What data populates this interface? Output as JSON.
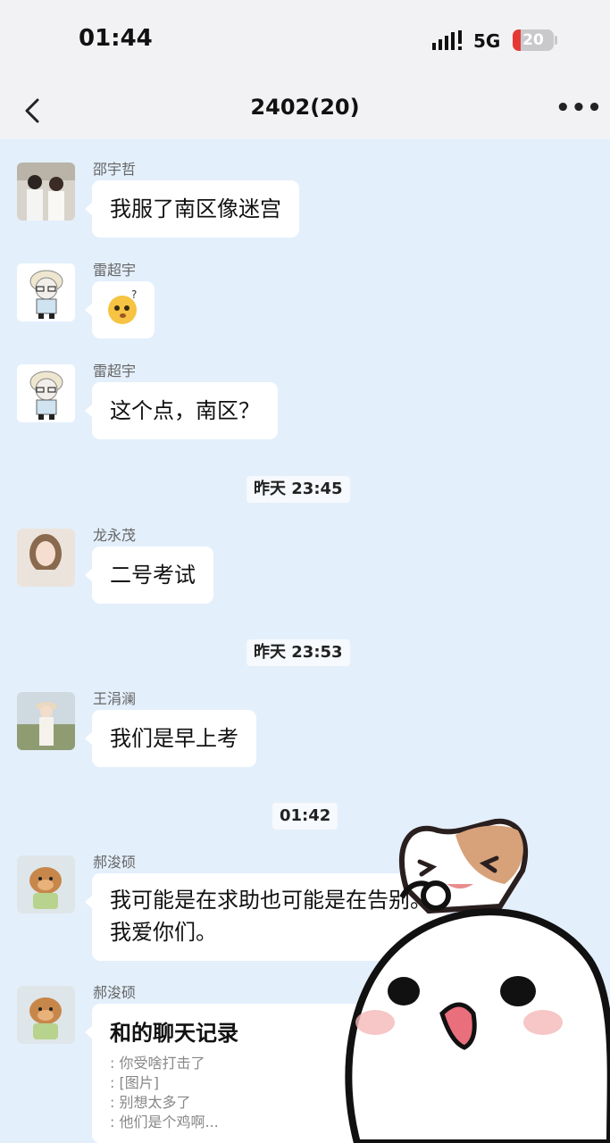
{
  "status_bar": {
    "time": "01:44",
    "network": "5G",
    "battery_level": "20",
    "battery_fraction": 0.2,
    "battery_color": "#e53935"
  },
  "nav": {
    "title": "2402(20)",
    "back_icon": "chevron-left-icon",
    "more_icon": "more-dots-icon"
  },
  "messages": [
    {
      "sender": "邵宇哲",
      "text": "我服了南区像迷宫"
    },
    {
      "sender": "雷超宇",
      "emoji": "confused-face-emoji"
    },
    {
      "sender": "雷超宇",
      "text": "这个点，南区？"
    },
    {
      "sender": "龙永茂",
      "text": "二号考试"
    },
    {
      "sender": "王涓澜",
      "text": "我们是早上考"
    },
    {
      "sender": "郝浚硕",
      "text_lines": [
        "我可能是在求助也可能是在告别。",
        "我爱你们。"
      ]
    },
    {
      "sender": "郝浚硕",
      "text": "和的聊天记录",
      "quoted": [
        ": 你受啥打击了",
        ": [图片]",
        ": 别想太多了",
        ": 他们是个鸡啊..."
      ]
    }
  ],
  "timestamps": [
    "昨天 23:45",
    "昨天 23:53",
    "01:42"
  ],
  "colors": {
    "background": "#e3effb",
    "bubble": "#ffffff",
    "header": "#f2f2f4"
  }
}
